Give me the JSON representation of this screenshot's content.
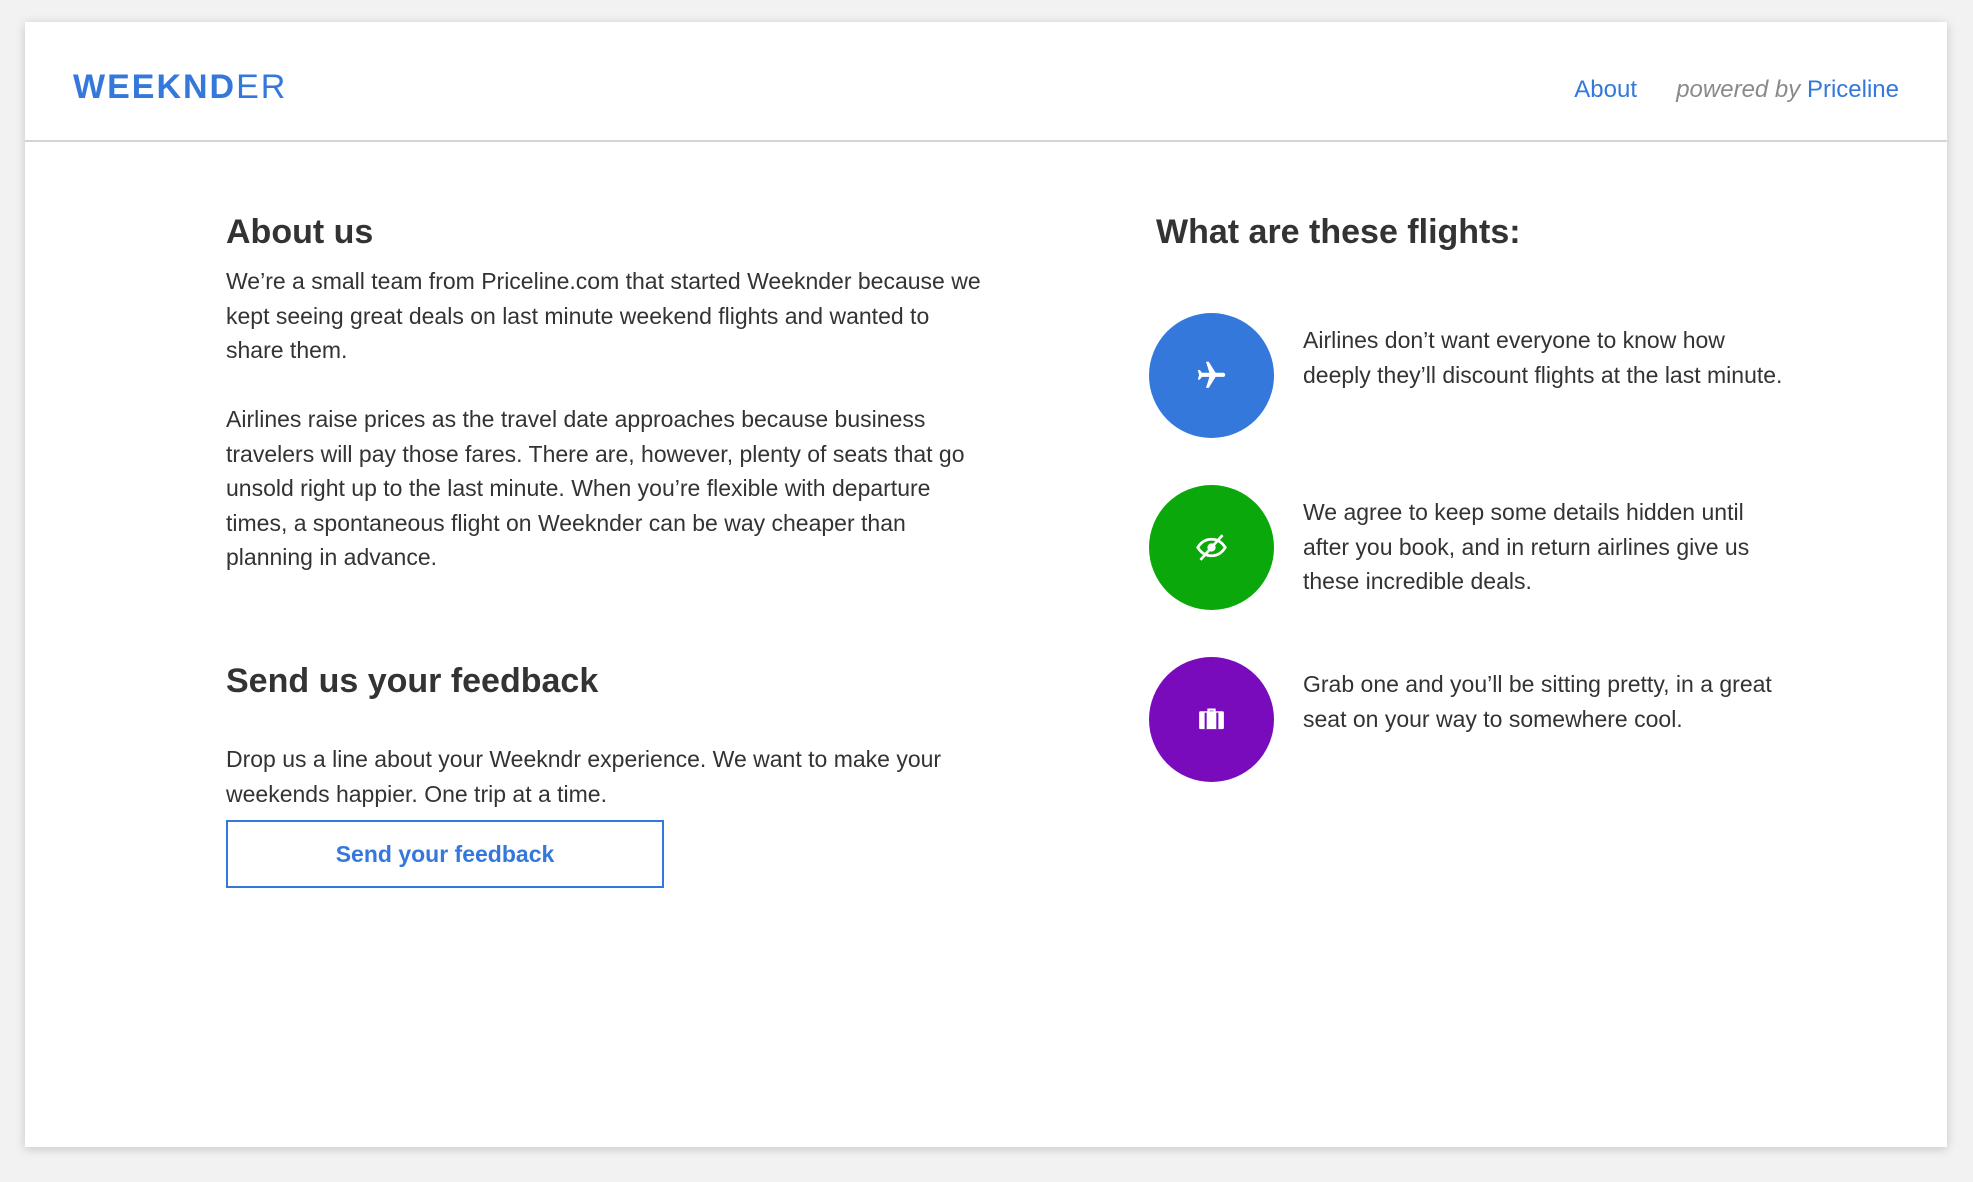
{
  "header": {
    "logo_bold": "WEEKND",
    "logo_light": "ER",
    "nav_about": "About",
    "powered_by": "powered by",
    "powered_brand": "Priceline"
  },
  "about": {
    "title": "About us",
    "p1": "We’re a small team from Priceline.com that started Weeknder because we kept seeing great deals on last minute weekend flights and wanted to share them.",
    "p2": "Airlines raise prices as the travel date approaches because business travelers will pay those fares. There are, however, plenty of seats that go unsold right up to the last minute. When you’re flexible with departure times, a spontaneous flight on Weeknder can be way cheaper than planning in advance."
  },
  "feedback": {
    "title": "Send us your feedback",
    "text": "Drop us a line about your Weekndr experience. We want to make your weekends happier. One trip at a time.",
    "button_label": "Send your feedback"
  },
  "flights": {
    "title": "What are these flights:",
    "items": [
      {
        "icon": "airplane-icon",
        "color": "#3478dc",
        "text": "Airlines don’t want everyone to know how deeply they’ll discount flights at the last minute."
      },
      {
        "icon": "eye-slash-icon",
        "color": "#0aa80a",
        "text": "We agree to keep some details hidden until after you book, and in return airlines give us these incredible deals."
      },
      {
        "icon": "suitcase-icon",
        "color": "#7a0bbd",
        "text": "Grab one and you’ll be sitting pretty, in a great seat on your way to somewhere cool."
      }
    ]
  }
}
